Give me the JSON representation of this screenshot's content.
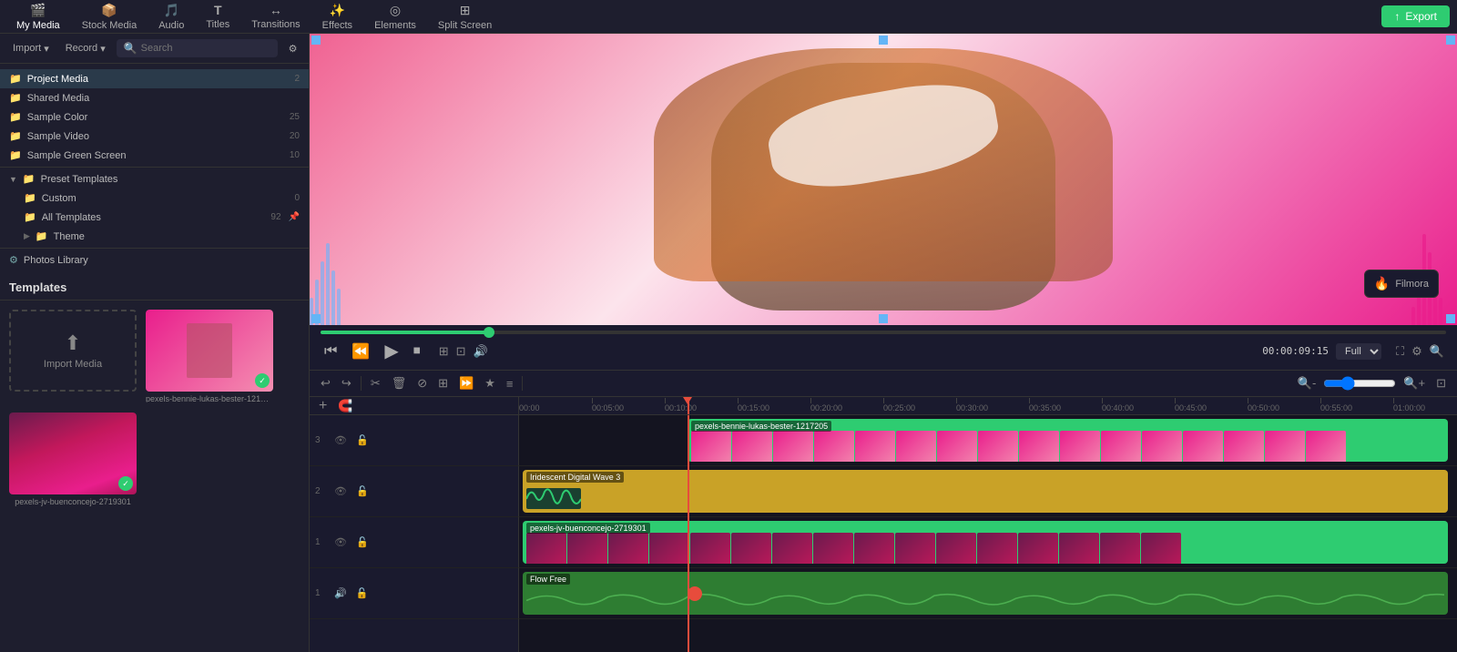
{
  "app": {
    "title": "Filmora"
  },
  "nav": {
    "items": [
      {
        "id": "my-media",
        "label": "My Media",
        "icon": "🎬",
        "active": true
      },
      {
        "id": "stock-media",
        "label": "Stock Media",
        "icon": "📦",
        "active": false
      },
      {
        "id": "audio",
        "label": "Audio",
        "icon": "🎵",
        "active": false
      },
      {
        "id": "titles",
        "label": "Titles",
        "icon": "T",
        "active": false
      },
      {
        "id": "transitions",
        "label": "Transitions",
        "icon": "↔",
        "active": false
      },
      {
        "id": "effects",
        "label": "Effects",
        "icon": "✨",
        "active": false
      },
      {
        "id": "elements",
        "label": "Elements",
        "icon": "◎",
        "active": false
      },
      {
        "id": "split-screen",
        "label": "Split Screen",
        "icon": "⊞",
        "active": false
      }
    ],
    "export_label": "Export"
  },
  "left_panel": {
    "import_label": "Import",
    "record_label": "Record",
    "search_placeholder": "Search",
    "templates_label": "Templates",
    "sidebar": [
      {
        "id": "project-media",
        "label": "Project Media",
        "count": "2",
        "indent": 0,
        "active": true
      },
      {
        "id": "shared-media",
        "label": "Shared Media",
        "count": "",
        "indent": 0,
        "active": false
      },
      {
        "id": "sample-color",
        "label": "Sample Color",
        "count": "25",
        "indent": 0,
        "active": false
      },
      {
        "id": "sample-video",
        "label": "Sample Video",
        "count": "20",
        "indent": 0,
        "active": false
      },
      {
        "id": "sample-green-screen",
        "label": "Sample Green Screen",
        "count": "10",
        "indent": 0,
        "active": false
      },
      {
        "id": "preset-templates",
        "label": "Preset Templates",
        "count": "",
        "indent": 0,
        "active": false,
        "expanded": true
      },
      {
        "id": "custom",
        "label": "Custom",
        "count": "0",
        "indent": 1,
        "active": false
      },
      {
        "id": "all-templates",
        "label": "All Templates",
        "count": "92",
        "indent": 1,
        "active": false
      },
      {
        "id": "theme",
        "label": "Theme",
        "count": "",
        "indent": 1,
        "active": false
      },
      {
        "id": "photos-library",
        "label": "Photos Library",
        "count": "",
        "indent": 0,
        "active": false
      }
    ]
  },
  "media_grid": {
    "import_media_label": "Import Media",
    "items": [
      {
        "id": "video1",
        "label": "pexels-bennie-lukas-bester-1217205",
        "has_check": true
      },
      {
        "id": "video2",
        "label": "pexels-jv-buenconcejo-2719301",
        "has_check": true
      }
    ]
  },
  "preview": {
    "time_current": "00:00:09:15",
    "quality": "Full",
    "scrubber_percent": 15
  },
  "timeline": {
    "ruler_marks": [
      "00:00",
      "00:05:00",
      "00:10:00",
      "00:15:00",
      "00:20:00",
      "00:25:00",
      "00:30:00",
      "00:35:00",
      "00:40:00",
      "00:45:00",
      "00:50:00",
      "00:55:00",
      "01:00:00"
    ],
    "tracks": [
      {
        "num": "3",
        "type": "video",
        "clip_label": "pexels-bennie-lukas-bester-1217205",
        "color": "#2ecc71"
      },
      {
        "num": "2",
        "type": "audio-gold",
        "clip_label": "Iridescent Digital Wave 3",
        "color": "#c9a227"
      },
      {
        "num": "1",
        "type": "video",
        "clip_label": "pexels-jv-buenconcejo-2719301",
        "color": "#2ecc71"
      },
      {
        "num": "1",
        "type": "music",
        "clip_label": "Flow Free",
        "color": "#2e7d32"
      }
    ]
  }
}
